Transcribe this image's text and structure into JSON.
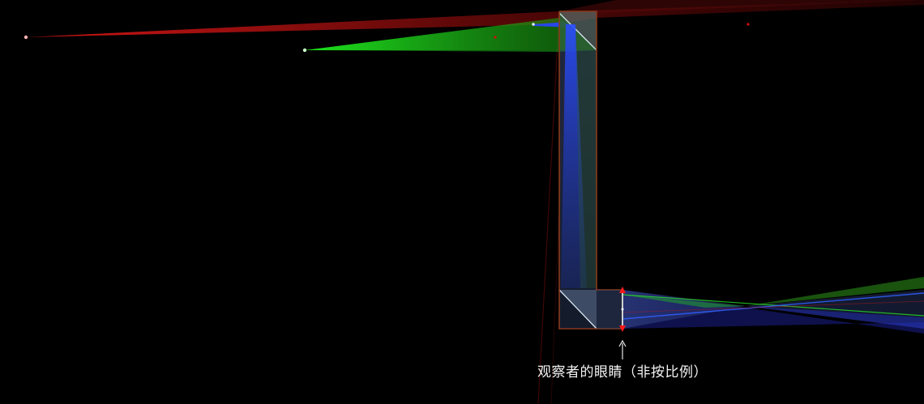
{
  "eye_label": "观察者的眼睛（非按比例）",
  "colors": {
    "background": "#000000",
    "housing": "#8a3a1c",
    "prism_glass": "#c8d8ec",
    "ray_red": "#ff2020",
    "ray_green": "#20ff20",
    "ray_blue": "#3050ff",
    "eye_marker": "#ff1a1a",
    "pupil": "#cfcfcf",
    "arrow": "#e6e6e6"
  }
}
